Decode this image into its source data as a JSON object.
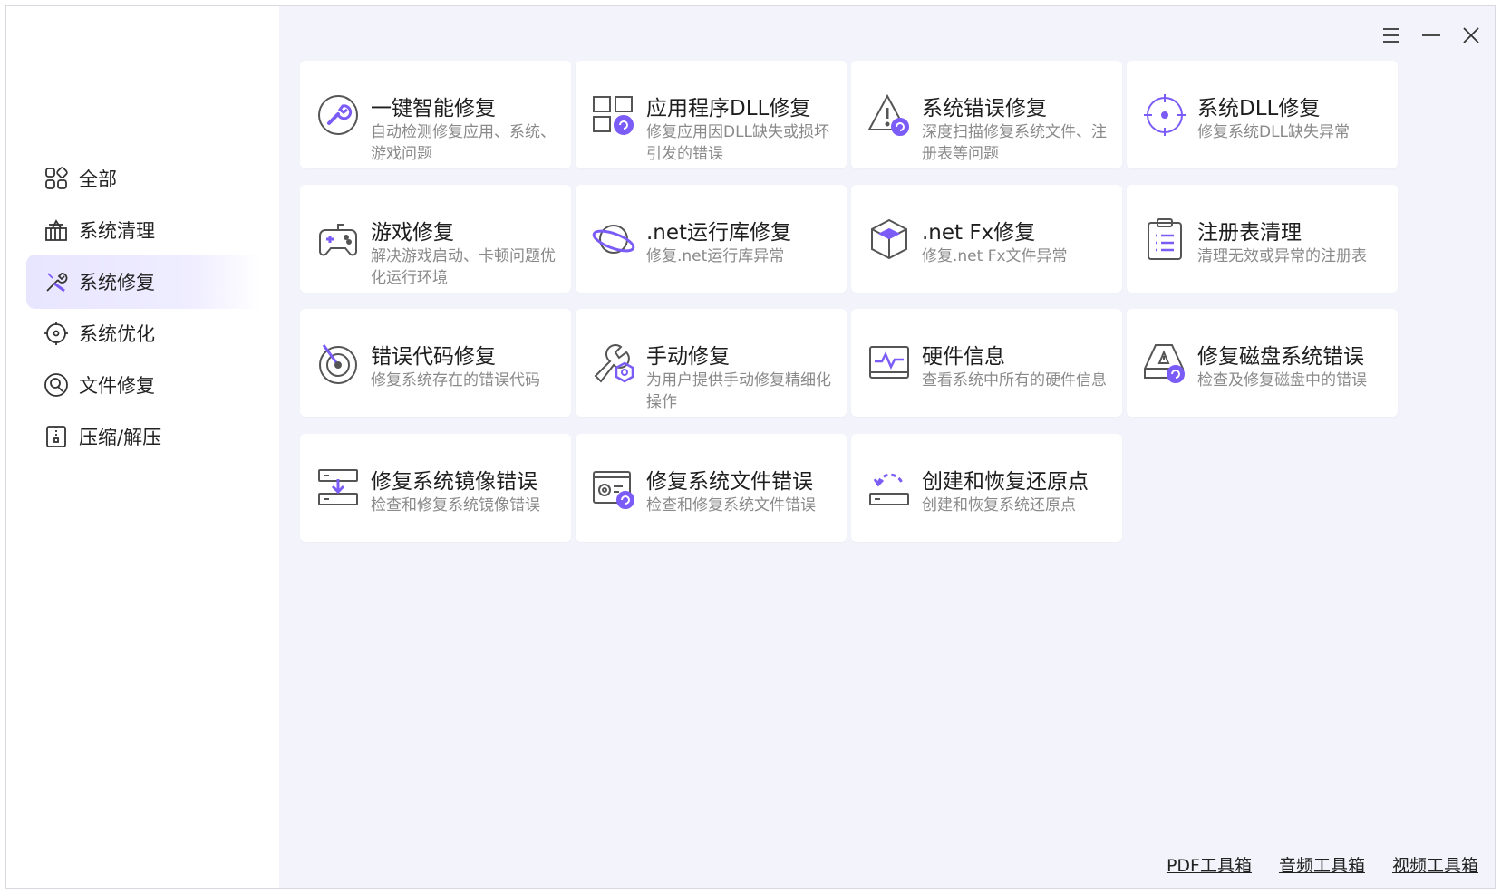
{
  "colors": {
    "accent": "#7c5cf6",
    "accent_light": "#e8e5ff",
    "icon_gray": "#555555",
    "background": "#f3f4fb"
  },
  "sidebar": {
    "items": [
      {
        "label": "全部",
        "icon": "grid-icon"
      },
      {
        "label": "系统清理",
        "icon": "broom-bucket-icon"
      },
      {
        "label": "系统修复",
        "icon": "tools-icon",
        "active": true
      },
      {
        "label": "系统优化",
        "icon": "target-icon"
      },
      {
        "label": "文件修复",
        "icon": "file-repair-icon"
      },
      {
        "label": "压缩/解压",
        "icon": "zip-icon"
      }
    ]
  },
  "window_controls": {
    "menu": "menu-icon",
    "minimize": "minimize-icon",
    "close": "close-icon"
  },
  "cards": [
    {
      "title": "一键智能修复",
      "desc": "自动检测修复应用、系统、游戏问题",
      "icon": "wrench-circle-icon"
    },
    {
      "title": "应用程序DLL修复",
      "desc": "修复应用因DLL缺失或损坏引发的错误",
      "icon": "dll-app-icon"
    },
    {
      "title": "系统错误修复",
      "desc": "深度扫描修复系统文件、注册表等问题",
      "icon": "warning-triangle-icon"
    },
    {
      "title": "系统DLL修复",
      "desc": "修复系统DLL缺失异常",
      "icon": "crosshair-icon"
    },
    {
      "title": "游戏修复",
      "desc": "解决游戏启动、卡顿问题优化运行环境",
      "icon": "gamepad-icon"
    },
    {
      "title": ".net运行库修复",
      "desc": "修复.net运行库异常",
      "icon": "planet-icon"
    },
    {
      "title": ".net Fx修复",
      "desc": "修复.net Fx文件异常",
      "icon": "cube-icon"
    },
    {
      "title": "注册表清理",
      "desc": "清理无效或异常的注册表",
      "icon": "clipboard-list-icon"
    },
    {
      "title": "错误代码修复",
      "desc": "修复系统存在的错误代码",
      "icon": "radar-icon"
    },
    {
      "title": "手动修复",
      "desc": "为用户提供手动修复精细化操作",
      "icon": "wrench-nut-icon"
    },
    {
      "title": "硬件信息",
      "desc": "查看系统中所有的硬件信息",
      "icon": "monitor-pulse-icon"
    },
    {
      "title": "修复磁盘系统错误",
      "desc": "检查及修复磁盘中的错误",
      "icon": "disk-warning-icon"
    },
    {
      "title": "修复系统镜像错误",
      "desc": "检查和修复系统镜像错误",
      "icon": "image-download-icon"
    },
    {
      "title": "修复系统文件错误",
      "desc": "检查和修复系统文件错误",
      "icon": "system-file-icon"
    },
    {
      "title": "创建和恢复还原点",
      "desc": "创建和恢复系统还原点",
      "icon": "restore-point-icon"
    }
  ],
  "footer": {
    "links": [
      "PDF工具箱",
      "音频工具箱",
      "视频工具箱"
    ]
  }
}
